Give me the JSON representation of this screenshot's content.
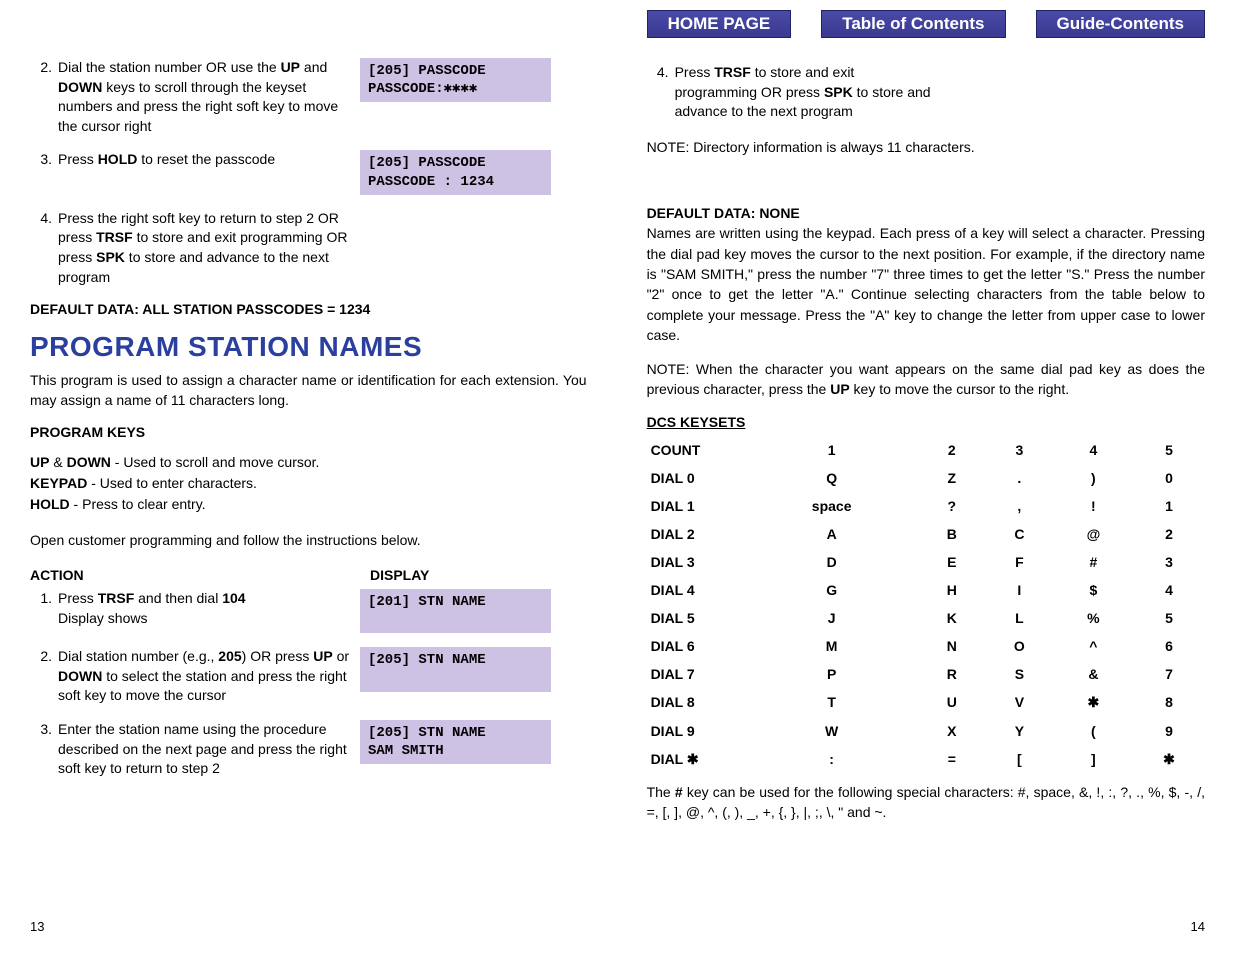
{
  "nav": {
    "home": "HOME PAGE",
    "toc": "Table of Contents",
    "guide": "Guide-Contents"
  },
  "left": {
    "step2": {
      "num": "2.",
      "text_pre": "Dial the station number OR use the ",
      "k1": "UP",
      "mid1": " and ",
      "k2": "DOWN",
      "text_post": " keys to scroll through the keyset numbers and press the right soft key to move the cursor right",
      "disp": "[205] PASSCODE\nPASSCODE:✱✱✱✱"
    },
    "step3": {
      "num": "3.",
      "pre": "Press ",
      "k": "HOLD",
      "post": " to reset the passcode",
      "disp": "[205] PASSCODE\nPASSCODE : 1234"
    },
    "step4": {
      "num": "4.",
      "a": "Press the right soft key to return to step 2 OR press ",
      "k1": "TRSF",
      "b": " to store and exit programming OR press ",
      "k2": "SPK",
      "c": " to store and advance to the next program"
    },
    "default_data": "DEFAULT DATA: ALL STATION PASSCODES = 1234",
    "title": "PROGRAM STATION NAMES",
    "intro": "This program is used to assign a character name or identification for each extension. You may assign a name of 11 characters long.",
    "progkeys_head": "PROGRAM KEYS",
    "pk1_a": "UP",
    "pk1_b": " & ",
    "pk1_c": "DOWN",
    "pk1_d": " - Used to scroll and move cursor.",
    "pk2_a": "KEYPAD",
    "pk2_b": " - Used to enter characters.",
    "pk3_a": "HOLD",
    "pk3_b": " - Press to clear entry.",
    "open": "Open customer programming and follow the instructions below.",
    "hdr_action": "ACTION",
    "hdr_display": "DISPLAY",
    "a1": {
      "num": "1.",
      "a": "Press ",
      "k1": "TRSF",
      "b": " and then dial ",
      "k2": "104",
      "c": "Display shows",
      "disp": "[201] STN NAME\n "
    },
    "a2": {
      "num": "2.",
      "a": "Dial station number (e.g., ",
      "k1": "205",
      "b": ") OR press ",
      "k2": "UP",
      "c": " or ",
      "k3": "DOWN",
      "d": " to select the station and press the right soft key to move the cursor",
      "disp": "[205] STN NAME\n "
    },
    "a3": {
      "num": "3.",
      "text": "Enter the station name using the procedure described on the next page and press the right soft key to return to step 2",
      "disp": "[205] STN NAME\nSAM SMITH"
    },
    "pagenum": "13"
  },
  "right": {
    "s4": {
      "num": "4.",
      "a": "Press ",
      "k1": "TRSF",
      "b": " to store and exit programming OR press ",
      "k2": "SPK",
      "c": " to store and advance to the next program"
    },
    "note1": "NOTE: Directory information is always 11 characters.",
    "dd_head": "DEFAULT DATA: NONE",
    "dd_body": "Names are written using the keypad. Each press of a key will select a character. Pressing the dial pad key moves the cursor to the next position. For example, if the directory name is \"SAM SMITH,\" press the number \"7\" three times to get the letter \"S.\" Press the number \"2\" once to get the letter \"A.\" Continue selecting characters from the table below to complete your message. Press the \"A\" key to change the letter from upper case to lower case.",
    "note2_a": "NOTE: When the character you want appears on the same dial pad key as does the previous character, press the ",
    "note2_k": "UP",
    "note2_b": " key to move the cursor to the right.",
    "keyset_head": "DCS KEYSETS",
    "table": {
      "head": [
        "COUNT",
        "1",
        "2",
        "3",
        "4",
        "5"
      ],
      "rows": [
        [
          "DIAL 0",
          "Q",
          "Z",
          ".",
          ")",
          "0"
        ],
        [
          "DIAL 1",
          "space",
          "?",
          ",",
          "!",
          "1"
        ],
        [
          "DIAL 2",
          "A",
          "B",
          "C",
          "@",
          "2"
        ],
        [
          "DIAL 3",
          "D",
          "E",
          "F",
          "#",
          "3"
        ],
        [
          "DIAL 4",
          "G",
          "H",
          "I",
          "$",
          "4"
        ],
        [
          "DIAL 5",
          "J",
          "K",
          "L",
          "%",
          "5"
        ],
        [
          "DIAL 6",
          "M",
          "N",
          "O",
          "^",
          "6"
        ],
        [
          "DIAL 7",
          "P",
          "R",
          "S",
          "&",
          "7"
        ],
        [
          "DIAL 8",
          "T",
          "U",
          "V",
          "✱",
          "8"
        ],
        [
          "DIAL 9",
          "W",
          "X",
          "Y",
          "(",
          "9"
        ],
        [
          "DIAL ✱",
          ":",
          "=",
          "[",
          "]",
          "✱"
        ]
      ]
    },
    "after_a": "The ",
    "after_k": "#",
    "after_b": " key can be used for the following special characters: #, space, &, !, :, ?, ., %, $, -, /, =, [, ], @, ^, (, ), _, +, {, }, |, ;, \\, \" and ~.",
    "pagenum": "14"
  }
}
